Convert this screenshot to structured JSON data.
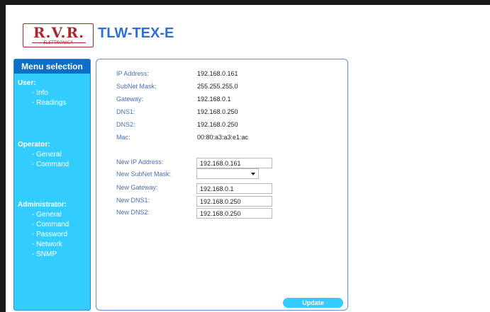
{
  "header": {
    "logo_text": "R.V.R.",
    "logo_subtext": "ELETTRONICA",
    "device_title": "TLW-TEX-E"
  },
  "sidebar": {
    "title": "Menu selection",
    "sections": [
      {
        "heading": "User:",
        "items": [
          "Info",
          "Readings"
        ]
      },
      {
        "heading": "Operator:",
        "items": [
          "General",
          "Command"
        ]
      },
      {
        "heading": "Administrator:",
        "items": [
          "General",
          "Command",
          "Password",
          "Network",
          "SNMP"
        ]
      }
    ]
  },
  "network_info": [
    {
      "label": "IP Address:",
      "value": "192.168.0.161"
    },
    {
      "label": "SubNet Mask:",
      "value": "255.255.255.0"
    },
    {
      "label": "Gateway:",
      "value": "192.168.0.1"
    },
    {
      "label": "DNS1:",
      "value": "192.168.0.250"
    },
    {
      "label": "DNS2:",
      "value": "192.168.0.250"
    },
    {
      "label": "Mac:",
      "value": "00:80:a3:a3:e1:ac"
    }
  ],
  "network_form": {
    "new_ip": {
      "label": "New IP Address:",
      "value": "192.168.0.161"
    },
    "new_subnet": {
      "label": "New SubNet Mask:",
      "value": ""
    },
    "new_gateway": {
      "label": "New Gateway:",
      "value": "192.168.0.1"
    },
    "new_dns1": {
      "label": "New DNS1:",
      "value": "192.168.0.250"
    },
    "new_dns2": {
      "label": "New DNS2:",
      "value": "192.168.0.250"
    }
  },
  "update_label": "Update"
}
